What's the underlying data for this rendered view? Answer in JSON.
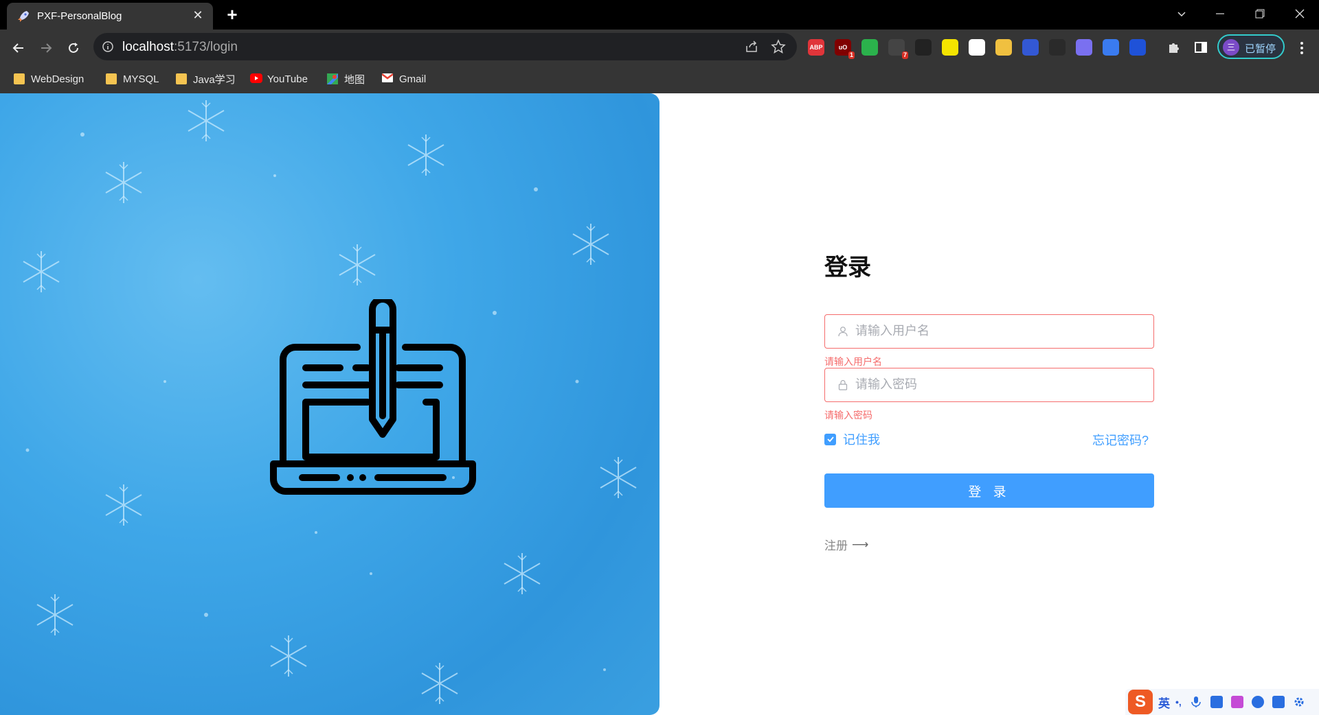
{
  "browser": {
    "tab_title": "PXF-PersonalBlog",
    "url_host": "localhost",
    "url_path": ":5173/login",
    "profile_label": "已暂停",
    "profile_initial": "三",
    "extensions": [
      {
        "name": "adblock-plus-icon",
        "label": "ABP",
        "color": "#e0353a"
      },
      {
        "name": "ublock-icon",
        "label": "uO",
        "color": "#800000",
        "badge": "1"
      },
      {
        "name": "shield-icon",
        "label": "",
        "color": "#2bb24c"
      },
      {
        "name": "extension-7-icon",
        "label": "",
        "color": "#444",
        "badge": "7"
      },
      {
        "name": "dice-icon",
        "label": "",
        "color": "#222"
      },
      {
        "name": "play-icon",
        "label": "",
        "color": "#f4e400"
      },
      {
        "name": "square-icon",
        "label": "",
        "color": "#fff"
      },
      {
        "name": "download-icon",
        "label": "",
        "color": "#f0c040"
      },
      {
        "name": "m-logo-icon",
        "label": "",
        "color": "#3358d4"
      },
      {
        "name": "terminal-icon",
        "label": "",
        "color": "#2a2a2a"
      },
      {
        "name": "people-icon",
        "label": "",
        "color": "#7a70f0"
      },
      {
        "name": "cloud-icon",
        "label": "",
        "color": "#3a7bf0"
      },
      {
        "name": "translate-icon",
        "label": "",
        "color": "#1f52d8"
      }
    ]
  },
  "bookmarks": [
    {
      "label": "WebDesign",
      "icon": "folder-icon"
    },
    {
      "label": "MYSQL",
      "icon": "folder-icon"
    },
    {
      "label": "Java学习",
      "icon": "folder-icon"
    },
    {
      "label": "YouTube",
      "icon": "youtube-icon"
    },
    {
      "label": "地图",
      "icon": "maps-icon"
    },
    {
      "label": "Gmail",
      "icon": "gmail-icon"
    }
  ],
  "login": {
    "title": "登录",
    "username_placeholder": "请输入用户名",
    "username_error": "请输入用户名",
    "password_placeholder": "请输入密码",
    "password_error": "请输入密码",
    "remember_label": "记住我",
    "remember_checked": true,
    "forgot_label": "忘记密码?",
    "submit_label": "登 录",
    "register_label": "注册"
  },
  "ime": {
    "logo": "S",
    "mode": "英",
    "punct": "•,"
  },
  "colors": {
    "primary": "#409eff",
    "error": "#f56c6c",
    "chrome_dark": "#353535"
  }
}
